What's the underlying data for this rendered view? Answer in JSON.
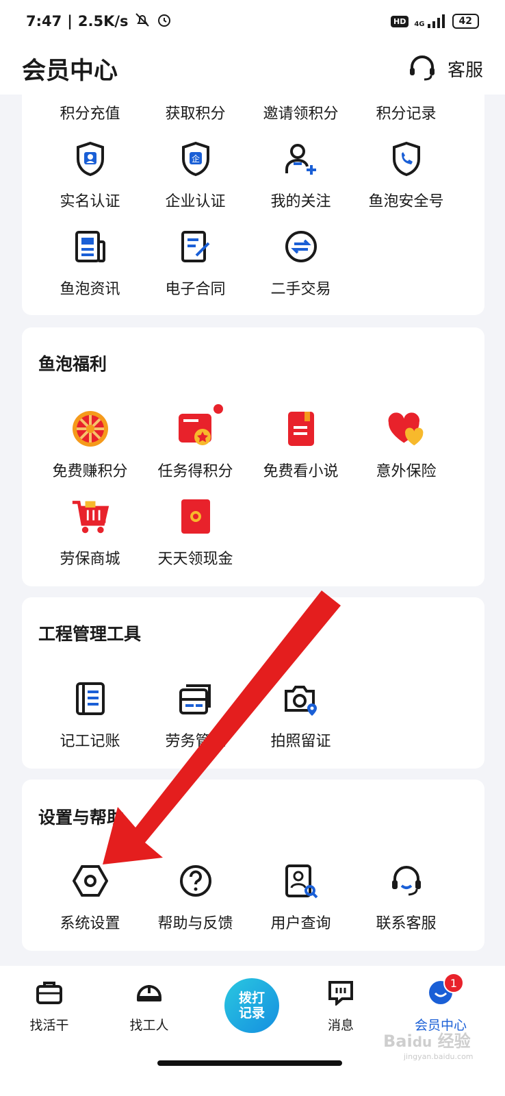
{
  "status_bar": {
    "time": "7:47",
    "speed": "2.5K/s",
    "network": "4G",
    "hd": "HD",
    "battery": "42"
  },
  "header": {
    "title": "会员中心",
    "service_label": "客服"
  },
  "top_section": {
    "row1": [
      "积分充值",
      "获取积分",
      "邀请领积分",
      "积分记录"
    ],
    "row2": [
      {
        "label": "实名认证",
        "icon": "shield-person-icon"
      },
      {
        "label": "企业认证",
        "icon": "shield-enterprise-icon"
      },
      {
        "label": "我的关注",
        "icon": "person-add-icon"
      },
      {
        "label": "鱼泡安全号",
        "icon": "shield-phone-icon"
      }
    ],
    "row3": [
      {
        "label": "鱼泡资讯",
        "icon": "news-icon"
      },
      {
        "label": "电子合同",
        "icon": "contract-edit-icon"
      },
      {
        "label": "二手交易",
        "icon": "exchange-icon"
      }
    ]
  },
  "welfare": {
    "title": "鱼泡福利",
    "items": [
      {
        "label": "免费赚积分",
        "icon": "lucky-wheel-icon"
      },
      {
        "label": "任务得积分",
        "icon": "task-card-icon"
      },
      {
        "label": "免费看小说",
        "icon": "book-icon"
      },
      {
        "label": "意外保险",
        "icon": "hearts-icon"
      },
      {
        "label": "劳保商城",
        "icon": "shopping-cart-icon"
      },
      {
        "label": "天天领现金",
        "icon": "red-envelope-icon"
      }
    ]
  },
  "tools": {
    "title": "工程管理工具",
    "items": [
      {
        "label": "记工记账",
        "icon": "ledger-icon"
      },
      {
        "label": "劳务管理",
        "icon": "labor-cards-icon"
      },
      {
        "label": "拍照留证",
        "icon": "camera-location-icon"
      }
    ]
  },
  "settings": {
    "title": "设置与帮助",
    "items": [
      {
        "label": "系统设置",
        "icon": "hexagon-nut-icon"
      },
      {
        "label": "帮助与反馈",
        "icon": "question-circle-icon"
      },
      {
        "label": "用户查询",
        "icon": "user-search-icon"
      },
      {
        "label": "联系客服",
        "icon": "headset-icon"
      }
    ]
  },
  "bottom_nav": {
    "items": [
      {
        "label": "找活干",
        "icon": "briefcase-icon"
      },
      {
        "label": "找工人",
        "icon": "hardhat-icon"
      },
      {
        "label": "消息",
        "icon": "message-icon"
      },
      {
        "label": "会员中心",
        "icon": "member-icon",
        "badge": "1"
      }
    ],
    "dial_line1": "拨打",
    "dial_line2": "记录"
  },
  "colors": {
    "accent_blue": "#1a5fd6",
    "red": "#e8222b",
    "arrow_red": "#e41e1e"
  }
}
